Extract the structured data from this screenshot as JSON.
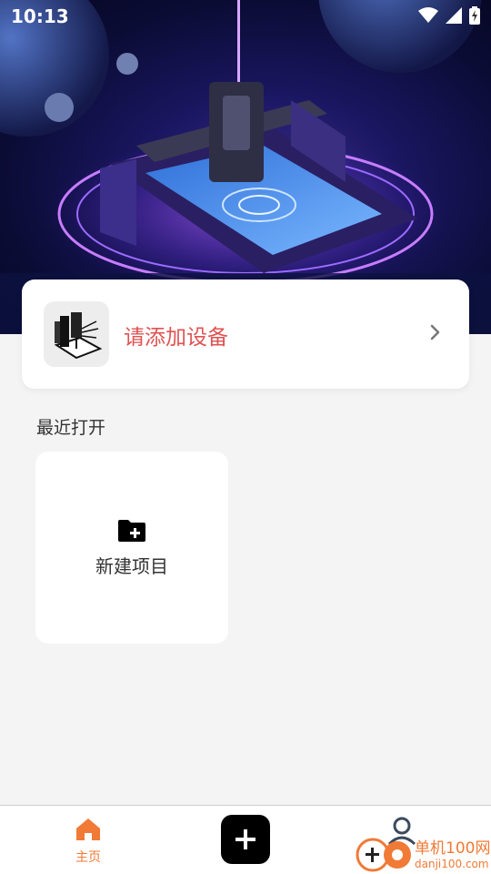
{
  "status_bar": {
    "time": "10:13"
  },
  "device_card": {
    "label": "请添加设备"
  },
  "recent": {
    "title": "最近打开",
    "new_project_label": "新建项目"
  },
  "bottom_nav": {
    "home_label": "主页"
  },
  "watermark": {
    "line1": "单机100网",
    "line2": "danji100.com"
  },
  "colors": {
    "accent": "#f07a36",
    "device_label": "#e05252",
    "background": "#f4f4f4"
  },
  "icons": [
    "wifi-icon",
    "signal-icon",
    "battery-icon",
    "laser-engraver-icon",
    "chevron-right-icon",
    "folder-add-icon",
    "home-icon",
    "plus-icon",
    "profile-icon"
  ]
}
